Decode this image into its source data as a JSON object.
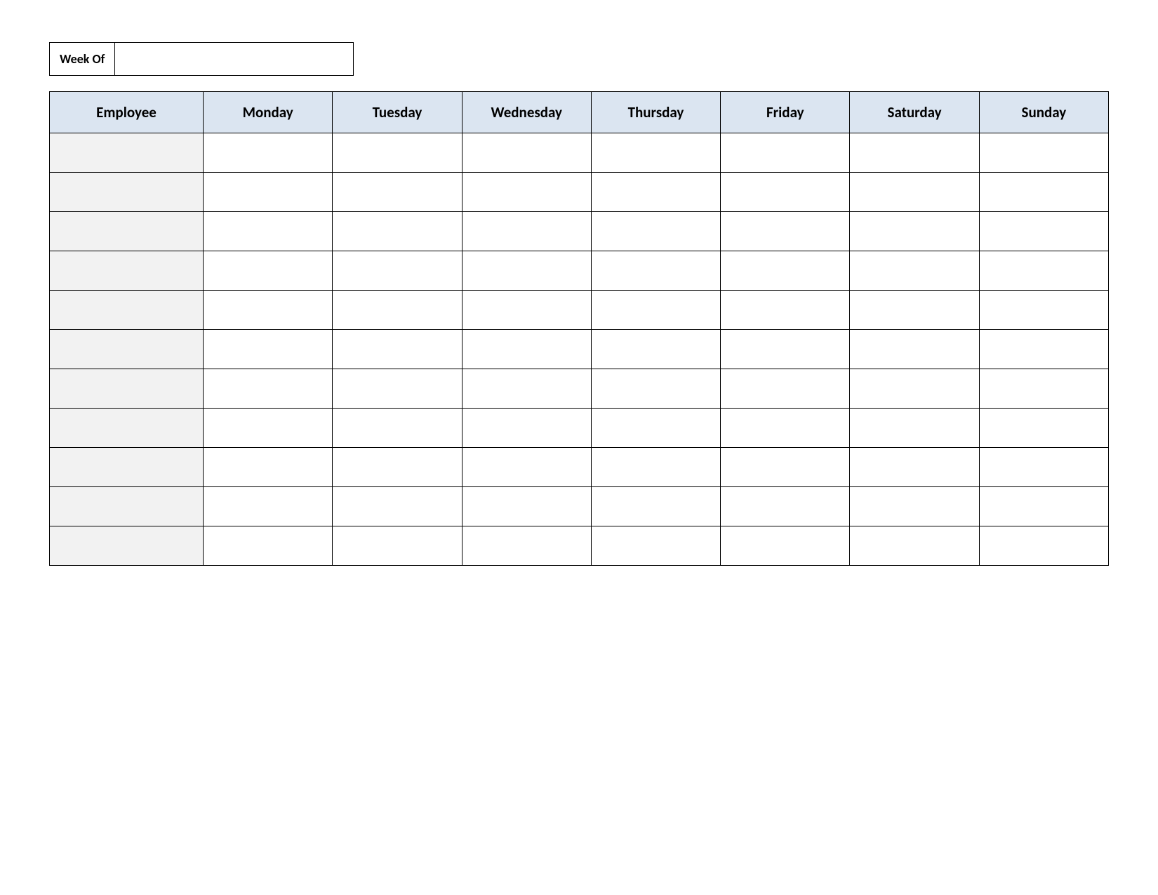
{
  "week_of": {
    "label": "Week Of",
    "value": ""
  },
  "table": {
    "headers": [
      "Employee",
      "Monday",
      "Tuesday",
      "Wednesday",
      "Thursday",
      "Friday",
      "Saturday",
      "Sunday"
    ],
    "rows": [
      {
        "employee": "",
        "monday": "",
        "tuesday": "",
        "wednesday": "",
        "thursday": "",
        "friday": "",
        "saturday": "",
        "sunday": ""
      },
      {
        "employee": "",
        "monday": "",
        "tuesday": "",
        "wednesday": "",
        "thursday": "",
        "friday": "",
        "saturday": "",
        "sunday": ""
      },
      {
        "employee": "",
        "monday": "",
        "tuesday": "",
        "wednesday": "",
        "thursday": "",
        "friday": "",
        "saturday": "",
        "sunday": ""
      },
      {
        "employee": "",
        "monday": "",
        "tuesday": "",
        "wednesday": "",
        "thursday": "",
        "friday": "",
        "saturday": "",
        "sunday": ""
      },
      {
        "employee": "",
        "monday": "",
        "tuesday": "",
        "wednesday": "",
        "thursday": "",
        "friday": "",
        "saturday": "",
        "sunday": ""
      },
      {
        "employee": "",
        "monday": "",
        "tuesday": "",
        "wednesday": "",
        "thursday": "",
        "friday": "",
        "saturday": "",
        "sunday": ""
      },
      {
        "employee": "",
        "monday": "",
        "tuesday": "",
        "wednesday": "",
        "thursday": "",
        "friday": "",
        "saturday": "",
        "sunday": ""
      },
      {
        "employee": "",
        "monday": "",
        "tuesday": "",
        "wednesday": "",
        "thursday": "",
        "friday": "",
        "saturday": "",
        "sunday": ""
      },
      {
        "employee": "",
        "monday": "",
        "tuesday": "",
        "wednesday": "",
        "thursday": "",
        "friday": "",
        "saturday": "",
        "sunday": ""
      },
      {
        "employee": "",
        "monday": "",
        "tuesday": "",
        "wednesday": "",
        "thursday": "",
        "friday": "",
        "saturday": "",
        "sunday": ""
      },
      {
        "employee": "",
        "monday": "",
        "tuesday": "",
        "wednesday": "",
        "thursday": "",
        "friday": "",
        "saturday": "",
        "sunday": ""
      }
    ]
  }
}
